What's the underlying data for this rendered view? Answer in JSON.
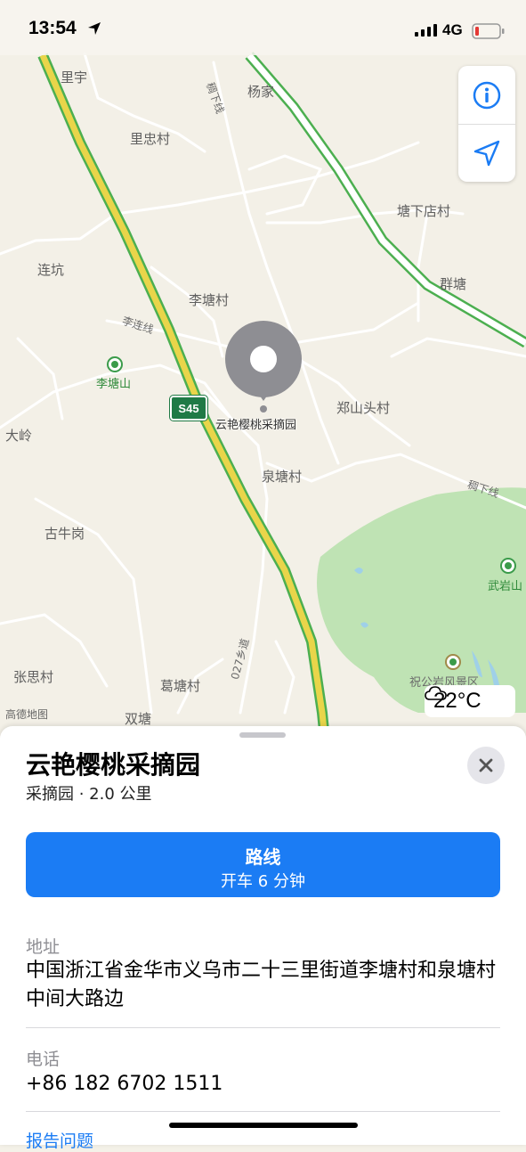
{
  "status_bar": {
    "time": "13:54",
    "network": "4G"
  },
  "map": {
    "labels": {
      "lizi": "里宇",
      "yangjia": "杨家",
      "lizhongcun": "里忠村",
      "tangxiadiancun": "塘下店村",
      "liankeng": "连坑",
      "quntang": "群塘",
      "litangcun": "李塘村",
      "litangshan": "李塘山",
      "dialing": "大岭",
      "zhengshantoucun": "郑山头村",
      "quantangcun": "泉塘村",
      "guniugang": "古牛岗",
      "wuyanshan": "武岩山",
      "zhangsicun": "张思村",
      "getangcun": "葛塘村",
      "shuangtang": "双塘",
      "zhugongyan": "祝公岩风景区"
    },
    "road_labels": {
      "chouxia_top": "稠下线",
      "lilian": "李连线",
      "chouxia_right": "稠下线",
      "xiang027": "027乡道"
    },
    "highway_shield": "S45",
    "pin_label": "云艳樱桃采摘园",
    "attribution": "高德地图",
    "weather_temp": "22°C",
    "colors": {
      "highway": "#e9d54a",
      "highway_edge": "#4caf50",
      "park": "#bfe3b4",
      "water": "#9fd0e8",
      "pin": "#8e8e93"
    }
  },
  "sheet": {
    "title": "云艳樱桃采摘园",
    "subtitle": "采摘园 · 2.0 公里",
    "route_label": "路线",
    "route_sub": "开车 6 分钟",
    "address_label": "地址",
    "address_value": "中国浙江省金华市义乌市二十三里街道李塘村和泉塘村中间大路边",
    "phone_label": "电话",
    "phone_value": "+86 182 6702 1511",
    "report_label": "报告问题",
    "accent": "#1b7cf4"
  }
}
